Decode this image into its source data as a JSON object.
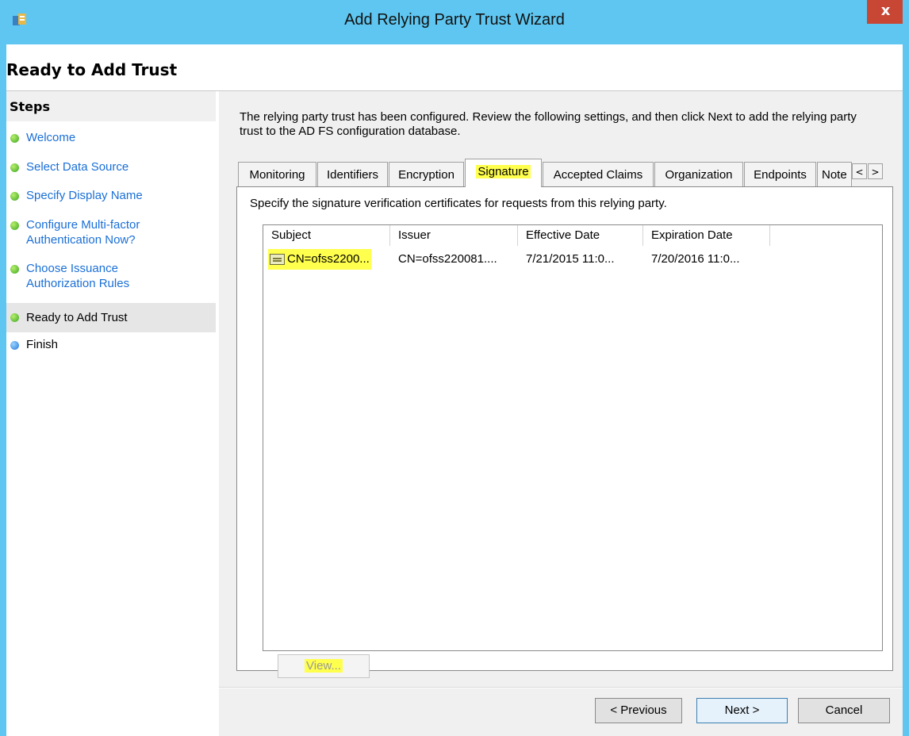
{
  "window": {
    "title": "Add Relying Party Trust Wizard",
    "close_label": "x"
  },
  "header": {
    "title": "Ready to Add Trust"
  },
  "steps": {
    "title": "Steps",
    "items": [
      {
        "label": "Welcome",
        "status": "done"
      },
      {
        "label": "Select Data Source",
        "status": "done"
      },
      {
        "label": "Specify Display Name",
        "status": "done"
      },
      {
        "label": "Configure Multi-factor Authentication Now?",
        "status": "done"
      },
      {
        "label": "Choose Issuance Authorization Rules",
        "status": "done"
      },
      {
        "label": "Ready to Add Trust",
        "status": "current"
      },
      {
        "label": "Finish",
        "status": "pending"
      }
    ]
  },
  "main": {
    "intro": "The relying party trust has been configured. Review the following settings, and then click Next to add the relying party trust to the AD FS configuration database.",
    "tabs": [
      {
        "label": "Monitoring"
      },
      {
        "label": "Identifiers"
      },
      {
        "label": "Encryption"
      },
      {
        "label": "Signature",
        "active": true
      },
      {
        "label": "Accepted Claims"
      },
      {
        "label": "Organization"
      },
      {
        "label": "Endpoints"
      },
      {
        "label": "Note"
      }
    ],
    "tab_scroll_left": "<",
    "tab_scroll_right": ">",
    "signature": {
      "description": "Specify the signature verification certificates for requests from this relying party.",
      "columns": [
        "Subject",
        "Issuer",
        "Effective Date",
        "Expiration Date"
      ],
      "rows": [
        {
          "subject": "CN=ofss2200...",
          "issuer": "CN=ofss220081....",
          "effective": "7/21/2015 11:0...",
          "expiration": "7/20/2016 11:0..."
        }
      ],
      "view_button": "View..."
    }
  },
  "footer": {
    "previous": "< Previous",
    "next": "Next >",
    "cancel": "Cancel"
  },
  "colors": {
    "frame": "#5ec6f0",
    "close": "#c74634",
    "link": "#1a6fd6",
    "highlight": "#ffff4d"
  }
}
